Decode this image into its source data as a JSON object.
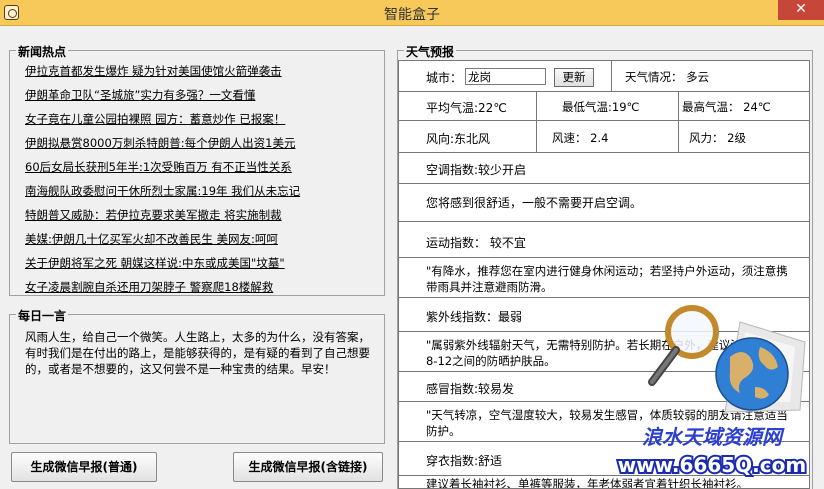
{
  "window": {
    "title": "智能盒子",
    "close_glyph": "✕"
  },
  "news": {
    "title": "新闻热点",
    "items": [
      "伊拉克首都发生爆炸 疑为针对美国使馆火箭弹袭击",
      "伊朗革命卫队“圣城旅”实力有多强？一文看懂",
      "女子竟在儿童公园拍裸照 园方：蓄意炒作 已报案！",
      "伊朗拟悬赏8000万刺杀特朗普:每个伊朗人出资1美元",
      "60后女局长获刑5年半:1次受贿百万 有不正当性关系",
      "南海舰队政委慰问干休所烈士家属:19年 我们从未忘记",
      "特朗普又威胁：若伊拉克要求美军撤走 将实施制裁",
      "美媒:伊朗几十亿买军火却不改善民生 美网友:呵呵",
      "关于伊朗将军之死 朝媒这样说:中东或成美国\"坟墓\"",
      "女子凌晨割腕自杀还用刀架脖子 警察爬18楼解救"
    ]
  },
  "quote": {
    "title": "每日一言",
    "text": "风雨人生，给自己一个微笑。人生路上，太多的为什么，没有答案，有时我们是在付出的路上，是能够获得的，是有疑的看到了自己想要的，或者是不想要的，这又何尝不是一种宝贵的结果。早安！"
  },
  "buttons": {
    "normal": "生成微信早报(普通)",
    "with_links": "生成微信早报(含链接)"
  },
  "weather": {
    "title": "天气预报",
    "city_label": "城市：",
    "city_value": "龙岗",
    "update_label": "更新",
    "condition": "天气情况： 多云",
    "avg_temp": "平均气温:22℃",
    "min_temp": "最低气温:19℃",
    "max_temp": "最高气温： 24℃",
    "wind_dir": "风向:东北风",
    "wind_speed": "风速：  2.4",
    "wind_power": "风力：  2级",
    "ac_index": "空调指数:较少开启",
    "ac_advice": "您将感到很舒适，一般不需要开启空调。",
    "sport_index": "运动指数： 较不宜",
    "sport_advice": "\"有降水，推荐您在室内进行健身休闲运动；若坚持户外运动，须注意携带雨具并注意避雨防滑。",
    "uv_index": "紫外线指数：最弱",
    "uv_advice": "\"属弱紫外线辐射天气，无需特别防护。若长期在户外，建议涂擦SPF在8-12之间的防晒护肤品。",
    "cold_index": "感冒指数:较易发",
    "cold_advice": "\"天气转凉，空气湿度较大，较易发生感冒，体质较弱的朋友请注意适当防护。",
    "dress_index": "穿衣指数:舒适",
    "dress_advice": "建议着长袖衬衫、单裤等服装，年老体弱者宜着针织长袖衬衫。"
  },
  "watermark": {
    "text": "浪水天域资源网",
    "url": "www.6665Q.com"
  },
  "colors": {
    "titlebar": "#f7c95a",
    "close": "#c7463a",
    "watermark": "#2b3fd0",
    "background": "#f0f0f0"
  }
}
